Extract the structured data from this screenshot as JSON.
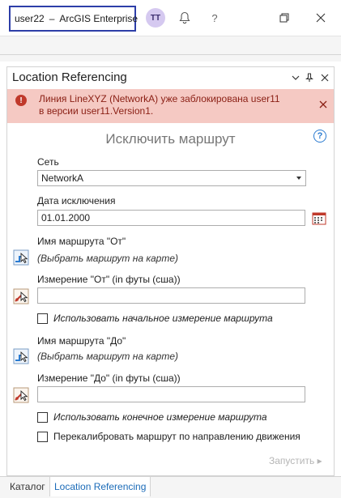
{
  "titlebar": {
    "user": "user22",
    "separator": "–",
    "portal": "ArcGIS Enterprise",
    "avatar_initials": "TT",
    "icons": [
      "bell-icon",
      "help-icon",
      "restore-icon",
      "close-icon"
    ],
    "help_glyph": "?"
  },
  "pane": {
    "title": "Location Referencing",
    "header_icons": [
      "chevron-down-icon",
      "pin-icon",
      "close-icon"
    ]
  },
  "banner": {
    "line1": "Линия LineXYZ (NetworkA) уже заблокирована user11",
    "line2": "в версии  user11.Version1.",
    "color": "#f5c9c3",
    "icon_glyph": "!"
  },
  "tool": {
    "title": "Исключить маршрут",
    "help_glyph": "?",
    "network_label": "Сеть",
    "network_value": "NetworkA",
    "date_label": "Дата исключения",
    "date_value": "01.01.2000",
    "from_route_label": "Имя маршрута \"От\"",
    "from_route_hint": "(Выбрать маршрут на карте)",
    "from_measure_label": "Измерение \"От\" (in футы (сша))",
    "from_measure_value": "",
    "use_start_label": "Использовать начальное измерение маршрута",
    "to_route_label": "Имя маршрута \"До\"",
    "to_route_hint": "(Выбрать маршрут на карте)",
    "to_measure_label": "Измерение \"До\" (in футы (сша))",
    "to_measure_value": "",
    "use_end_label": "Использовать конечное измерение маршрута",
    "recalibrate_label": "Перекалибровать маршрут по направлению движения",
    "run_label": "Запустить ▸"
  },
  "bottom_tabs": [
    {
      "label": "Каталог",
      "active": false
    },
    {
      "label": "Location Referencing",
      "active": true
    }
  ],
  "colors": {
    "accent": "#1b6bb8",
    "highlight_border": "#2d3ea8",
    "error_text": "#8a1f14"
  }
}
